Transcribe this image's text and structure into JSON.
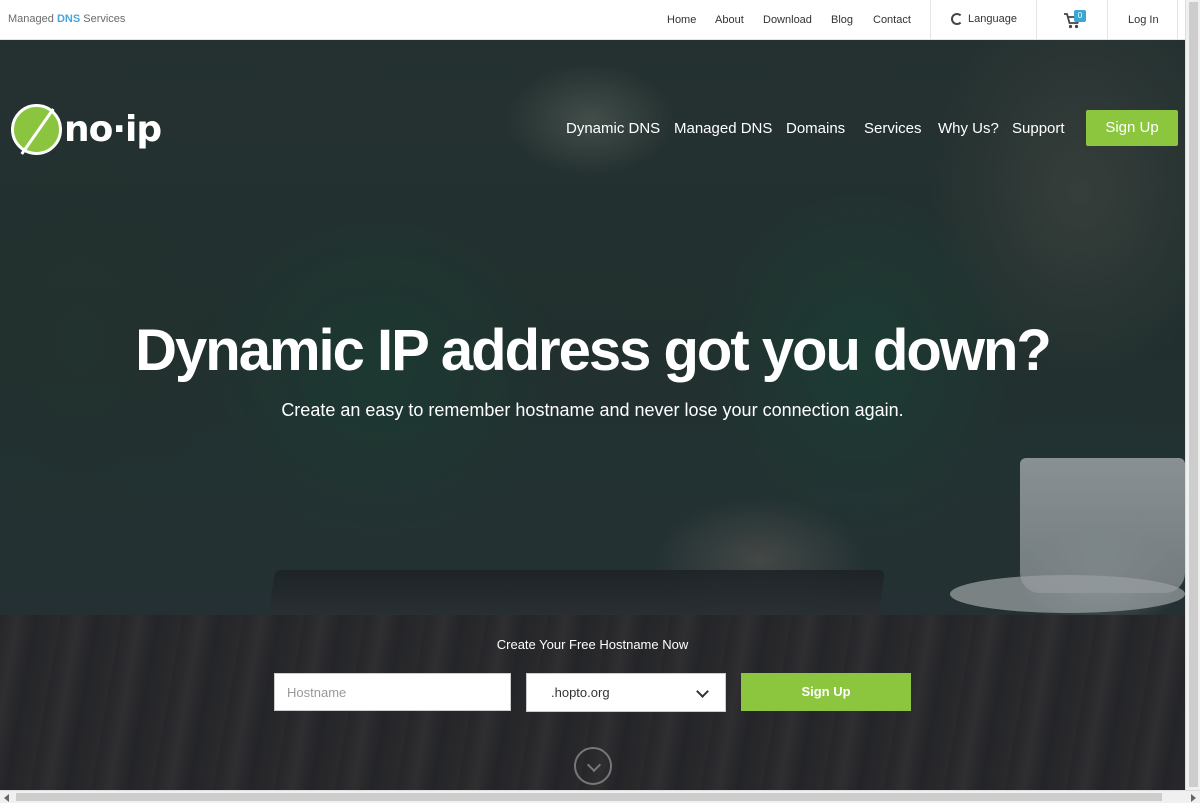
{
  "topbar": {
    "tagline_prefix": "Managed",
    "tagline_highlight": "DNS",
    "tagline_suffix": "Services",
    "links": {
      "home": "Home",
      "about": "About",
      "download": "Download",
      "blog": "Blog",
      "contact": "Contact"
    },
    "language": "Language",
    "cart_count": "0",
    "login": "Log In"
  },
  "brand": {
    "logo_text": "no·ip",
    "accent_color": "#8cc63f",
    "link_color": "#3aa6d3"
  },
  "nav": {
    "dynamic_dns": "Dynamic DNS",
    "managed_dns": "Managed DNS",
    "domains": "Domains",
    "services": "Services",
    "why_us": "Why Us?",
    "support": "Support",
    "signup": "Sign Up"
  },
  "hero": {
    "headline": "Dynamic IP address got you down?",
    "subline": "Create an easy to remember hostname and never lose your connection again."
  },
  "form": {
    "title": "Create Your Free Hostname Now",
    "hostname_placeholder": "Hostname",
    "domain_selected": ".hopto.org",
    "submit": "Sign Up"
  },
  "icons": {
    "language": "globe-icon",
    "cart": "cart-icon",
    "select": "chevron-down-icon",
    "scroll": "scroll-down-icon"
  }
}
